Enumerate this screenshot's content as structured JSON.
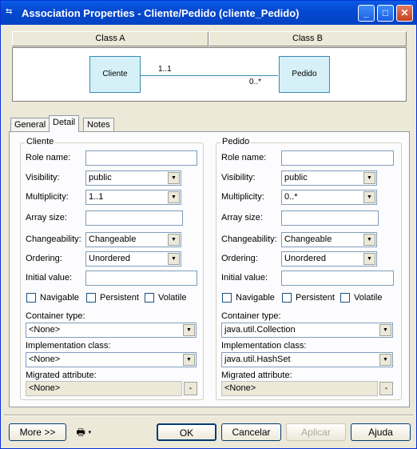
{
  "window": {
    "title": "Association Properties - Cliente/Pedido (cliente_Pedido)"
  },
  "header": {
    "class_a": "Class A",
    "class_b": "Class B"
  },
  "diagram": {
    "class_a": "Cliente",
    "class_b": "Pedido",
    "mult_a": "1..1",
    "mult_b": "0..*"
  },
  "tabs": [
    {
      "label": "General"
    },
    {
      "label": "Detail"
    },
    {
      "label": "Notes"
    }
  ],
  "active_tab": "Detail",
  "left": {
    "group": "Cliente",
    "role_name_label": "Role name:",
    "role_name": "",
    "visibility_label": "Visibility:",
    "visibility": "public",
    "multiplicity_label": "Multiplicity:",
    "multiplicity": "1..1",
    "array_size_label": "Array size:",
    "array_size": "",
    "changeability_label": "Changeability:",
    "changeability": "Changeable",
    "ordering_label": "Ordering:",
    "ordering": "Unordered",
    "initial_value_label": "Initial value:",
    "initial_value": "",
    "navigable_label": "Navigable",
    "persistent_label": "Persistent",
    "volatile_label": "Volatile",
    "container_type_label": "Container type:",
    "container_type": "<None>",
    "impl_class_label": "Implementation class:",
    "impl_class": "<None>",
    "migrated_label": "Migrated attribute:",
    "migrated": "<None>"
  },
  "right": {
    "group": "Pedido",
    "role_name_label": "Role name:",
    "role_name": "",
    "visibility_label": "Visibility:",
    "visibility": "public",
    "multiplicity_label": "Multiplicity:",
    "multiplicity": "0..*",
    "array_size_label": "Array size:",
    "array_size": "",
    "changeability_label": "Changeability:",
    "changeability": "Changeable",
    "ordering_label": "Ordering:",
    "ordering": "Unordered",
    "initial_value_label": "Initial value:",
    "initial_value": "",
    "navigable_label": "Navigable",
    "persistent_label": "Persistent",
    "volatile_label": "Volatile",
    "container_type_label": "Container type:",
    "container_type": "java.util.Collection",
    "impl_class_label": "Implementation class:",
    "impl_class": "java.util.HashSet",
    "migrated_label": "Migrated attribute:",
    "migrated": "<None>"
  },
  "buttons": {
    "more": "More >>",
    "ok": "OK",
    "cancel": "Cancelar",
    "apply": "Aplicar",
    "help": "Ajuda"
  },
  "icons": {
    "app": "association-icon",
    "tool": "printer-icon"
  },
  "colors": {
    "titlebar": "#0548d0",
    "class_fill": "#d6f0f8",
    "class_border": "#3a8ab5"
  }
}
